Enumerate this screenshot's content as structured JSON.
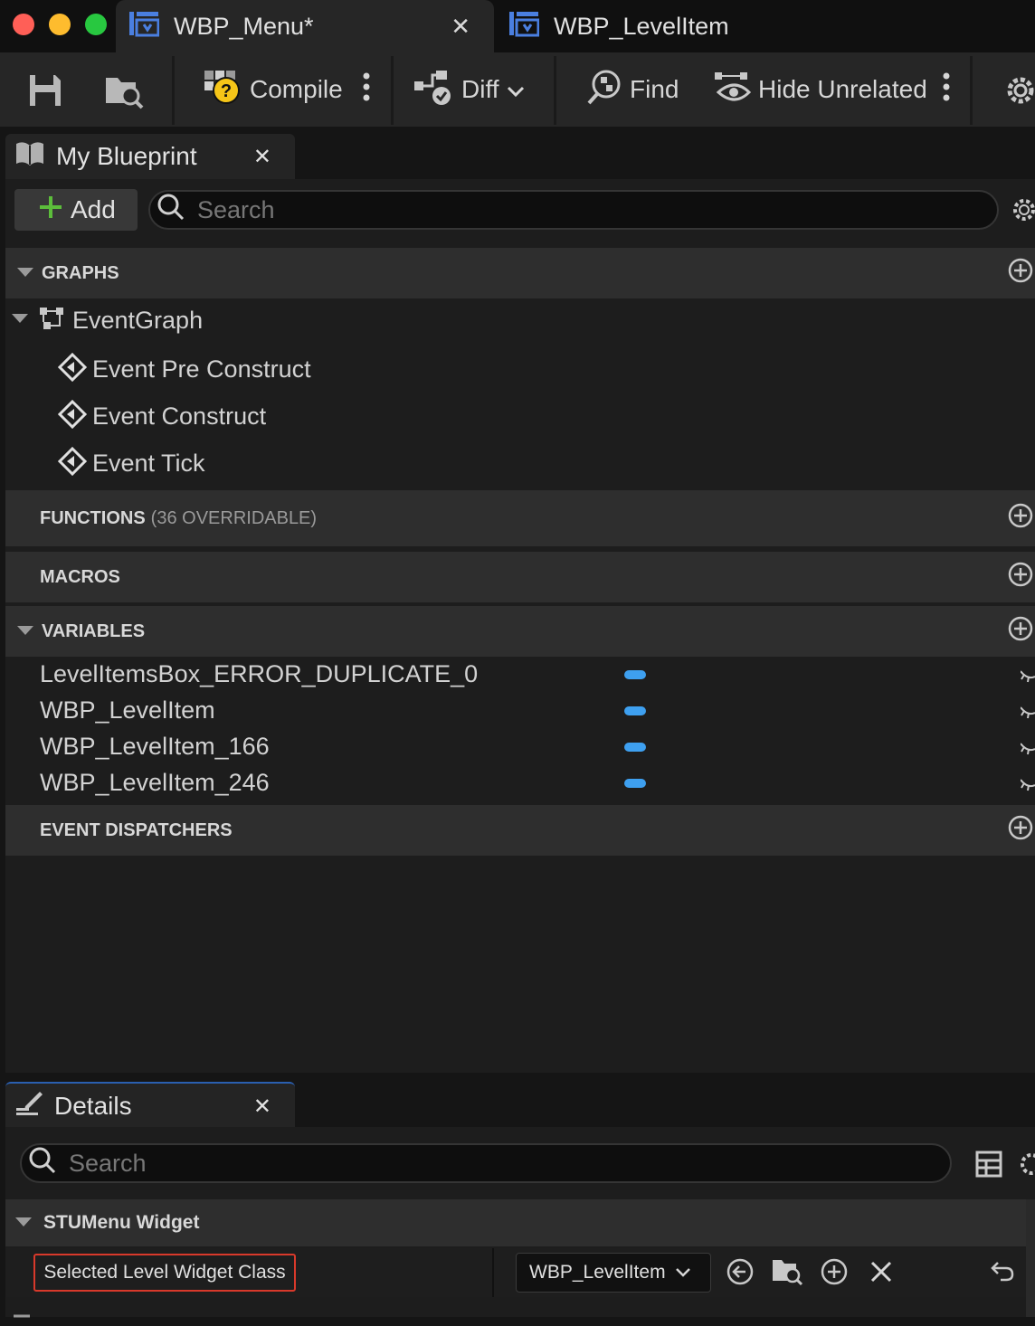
{
  "tabs": [
    {
      "label": "WBP_Menu*"
    },
    {
      "label": "WBP_LevelItem"
    }
  ],
  "toolbar": {
    "compile": "Compile",
    "diff": "Diff",
    "find": "Find",
    "hide_unrelated": "Hide Unrelated"
  },
  "my_blueprint": {
    "title": "My Blueprint",
    "add_label": "Add",
    "search_placeholder": "Search",
    "sections": {
      "graphs": "GRAPHS",
      "functions": "FUNCTIONS",
      "functions_count": "(36 OVERRIDABLE)",
      "macros": "MACROS",
      "variables": "VARIABLES",
      "event_dispatchers": "EVENT DISPATCHERS"
    },
    "event_graph": "EventGraph",
    "events": [
      "Event Pre Construct",
      "Event Construct",
      "Event Tick"
    ],
    "variables": [
      "LevelItemsBox_ERROR_DUPLICATE_0",
      "WBP_LevelItem",
      "WBP_LevelItem_166",
      "WBP_LevelItem_246"
    ]
  },
  "details": {
    "title": "Details",
    "search_placeholder": "Search",
    "category": "STUMenu Widget",
    "property_label": "Selected Level Widget Class",
    "property_value": "WBP_LevelItem"
  },
  "colors": {
    "accent_blue": "#3ea0f0",
    "highlight_red": "#d8392b",
    "add_green": "#5cbd3b"
  }
}
